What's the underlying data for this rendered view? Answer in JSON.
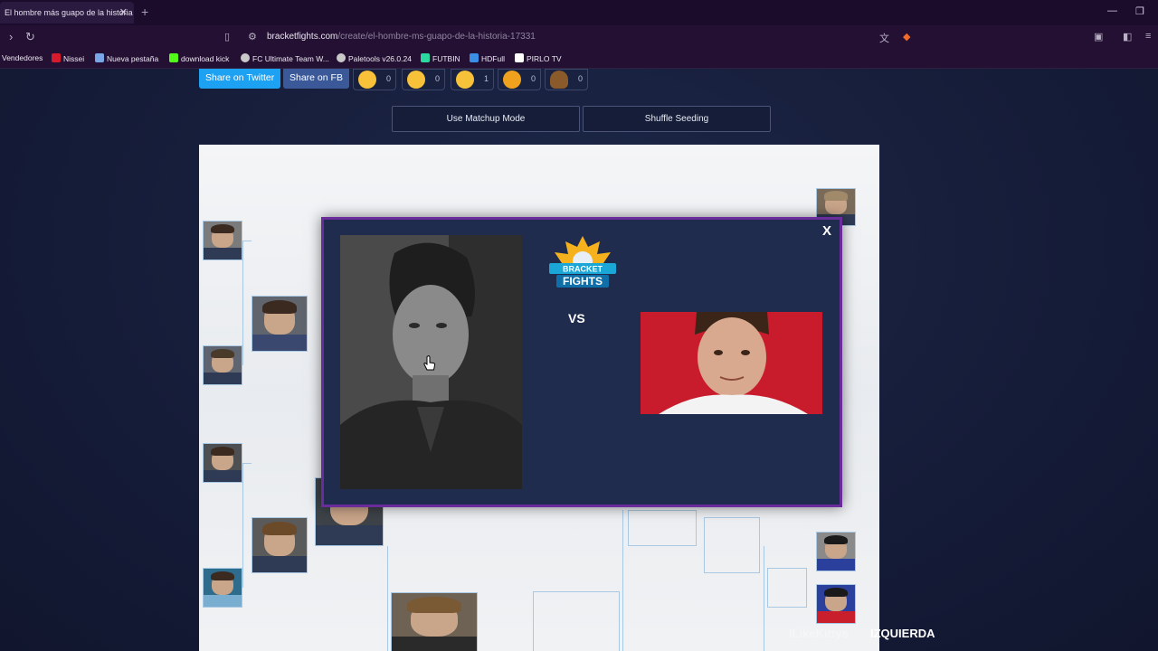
{
  "browser": {
    "tab_title": "El hombre más guapo de la historia",
    "tab_close": "✕",
    "new_tab": "+",
    "url_domain": "bracketfights.com",
    "url_path": "/create/el-hombre-ms-guapo-de-la-historia-17331",
    "bookmarks": [
      {
        "label": "Vendedores",
        "color": ""
      },
      {
        "label": "Nissei",
        "color": "#d81b2c"
      },
      {
        "label": "Nueva pestaña",
        "color": "#7aa6e8"
      },
      {
        "label": "download kick",
        "color": "#53fc18"
      },
      {
        "label": "FC Ultimate Team W...",
        "color": "#c9c9c9"
      },
      {
        "label": "Paletools v26.0.24",
        "color": "#c9c9c9"
      },
      {
        "label": "FUTBIN",
        "color": "#2bd9a0"
      },
      {
        "label": "HDFull",
        "color": "#3a8ee6"
      },
      {
        "label": "PIRLO TV",
        "color": "#ffffff"
      }
    ]
  },
  "toolbar": {
    "share_twitter": "Share on Twitter",
    "share_fb": "Share on FB",
    "reactions": [
      {
        "name": "love-reaction",
        "count": "0",
        "color": "#f7c23a"
      },
      {
        "name": "laugh-reaction",
        "count": "0",
        "color": "#f7c23a"
      },
      {
        "name": "neutral-reaction",
        "count": "1",
        "color": "#f7c23a"
      },
      {
        "name": "angry-reaction",
        "count": "0",
        "color": "#f0a21f"
      },
      {
        "name": "poop-reaction",
        "count": "0",
        "color": "#8a5a2b"
      }
    ],
    "matchup_mode": "Use Matchup Mode",
    "shuffle": "Shuffle Seeding"
  },
  "modal": {
    "close": "X",
    "vs": "VS",
    "logo_top": "BRACKET",
    "logo_bottom": "FIGHTS"
  },
  "overlay": {
    "handle": "ILikeKittys",
    "direction": "IZQUIERDA"
  },
  "colors": {
    "twitter": "#1da1f2",
    "fb": "#3b5998",
    "modal_border": "#6a2c9a",
    "modal_bg": "#1f2c4e"
  }
}
